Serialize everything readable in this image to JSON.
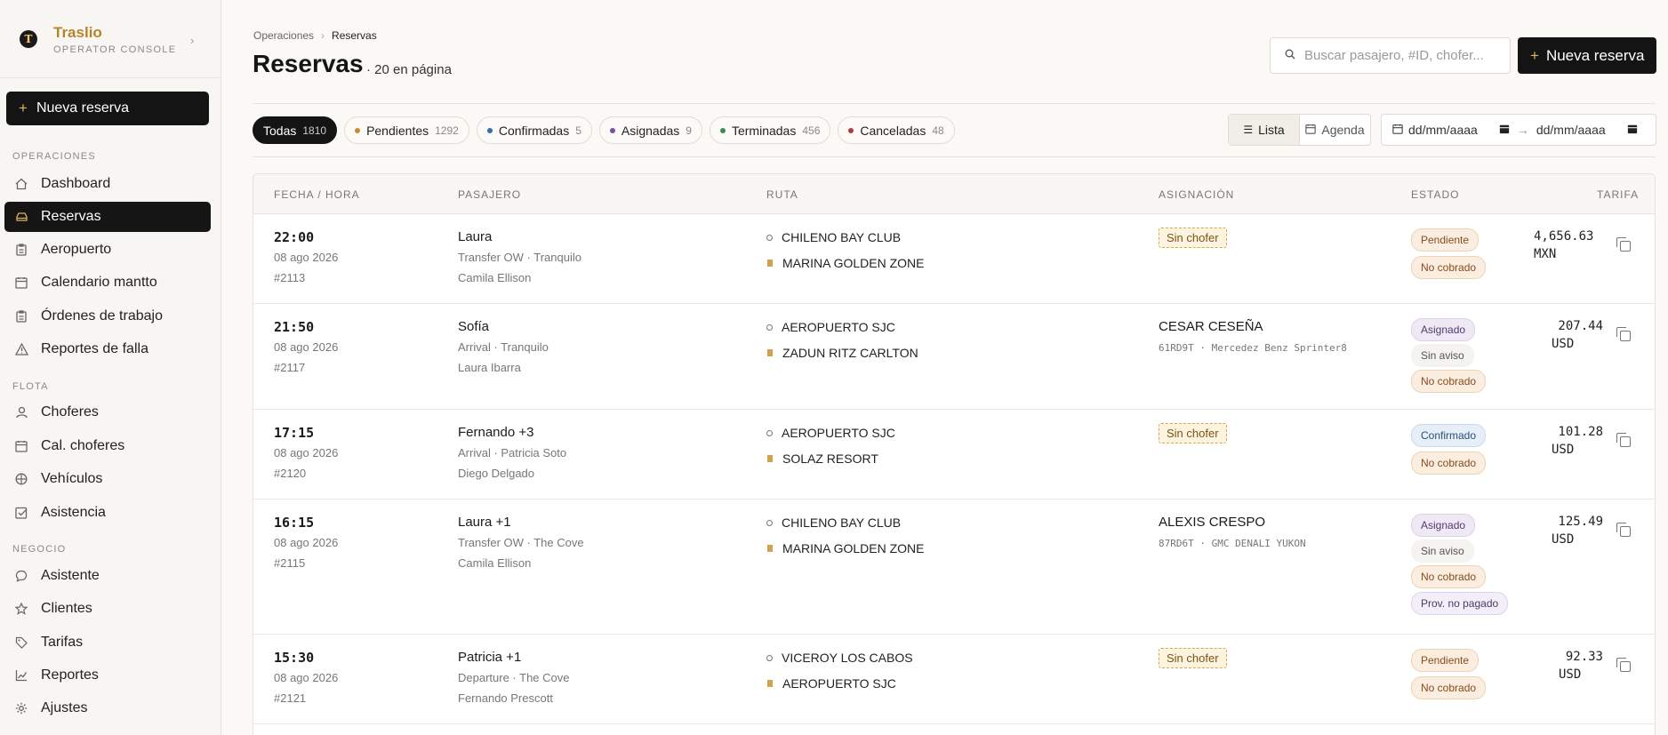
{
  "brand": {
    "name": "Traslio",
    "subtitle": "OPERATOR CONSOLE"
  },
  "sidebar": {
    "new_button": "Nueva reserva",
    "sections": [
      {
        "label": "OPERACIONES",
        "items": [
          {
            "label": "Dashboard",
            "icon": "home-icon"
          },
          {
            "label": "Reservas",
            "icon": "car-icon",
            "active": true
          },
          {
            "label": "Aeropuerto",
            "icon": "clipboard-icon"
          },
          {
            "label": "Calendario mantto",
            "icon": "calendar-icon"
          },
          {
            "label": "Órdenes de trabajo",
            "icon": "clipboard-icon"
          },
          {
            "label": "Reportes de falla",
            "icon": "warning-icon"
          }
        ]
      },
      {
        "label": "FLOTA",
        "items": [
          {
            "label": "Choferes",
            "icon": "user-icon"
          },
          {
            "label": "Cal. choferes",
            "icon": "calendar-icon"
          },
          {
            "label": "Vehículos",
            "icon": "globe-icon"
          },
          {
            "label": "Asistencia",
            "icon": "check-square-icon"
          }
        ]
      },
      {
        "label": "NEGOCIO",
        "items": [
          {
            "label": "Asistente",
            "icon": "chat-icon"
          },
          {
            "label": "Clientes",
            "icon": "star-icon"
          },
          {
            "label": "Tarifas",
            "icon": "tag-icon"
          },
          {
            "label": "Reportes",
            "icon": "chart-icon"
          },
          {
            "label": "Ajustes",
            "icon": "gear-icon"
          }
        ]
      }
    ]
  },
  "header": {
    "breadcrumb": [
      "Operaciones",
      "Reservas"
    ],
    "title": "Reservas",
    "count_text": "· 20 en página",
    "search_placeholder": "Buscar pasajero, #ID, chofer...",
    "new_button": "Nueva reserva"
  },
  "filters": [
    {
      "label": "Todas",
      "count": "1810",
      "active": true,
      "color": ""
    },
    {
      "label": "Pendientes",
      "count": "1292",
      "color": "#c98a2e"
    },
    {
      "label": "Confirmadas",
      "count": "5",
      "color": "#3b6ea8"
    },
    {
      "label": "Asignadas",
      "count": "9",
      "color": "#7a4fa0"
    },
    {
      "label": "Terminadas",
      "count": "456",
      "color": "#3e8a4f"
    },
    {
      "label": "Canceladas",
      "count": "48",
      "color": "#b23a3a"
    }
  ],
  "view": {
    "list": "Lista",
    "agenda": "Agenda"
  },
  "daterange": {
    "from": "dd/mm/aaaa",
    "to": "dd/mm/aaaa"
  },
  "table": {
    "headers": {
      "date": "FECHA / HORA",
      "passenger": "PASAJERO",
      "route": "RUTA",
      "assignment": "ASIGNACIÓN",
      "status": "ESTADO",
      "fare": "TARIFA"
    },
    "rows": [
      {
        "time": "22:00",
        "date": "08 ago 2026",
        "id": "#2113",
        "passenger": "Laura",
        "service": "Transfer OW · Tranquilo",
        "agent": "Camila Ellison",
        "from": "CHILENO BAY CLUB",
        "to": "MARINA GOLDEN ZONE",
        "assignment": "Sin chofer",
        "vehicle": "",
        "badges": [
          "Pendiente",
          "No cobrado"
        ],
        "fare": "4,656.63",
        "currency": "MXN"
      },
      {
        "time": "21:50",
        "date": "08 ago 2026",
        "id": "#2117",
        "passenger": "Sofía",
        "service": "Arrival · Tranquilo",
        "agent": "Laura Ibarra",
        "from": "AEROPUERTO SJC",
        "to": "ZADUN RITZ CARLTON",
        "assignment": "CESAR CESEÑA",
        "vehicle": "61RD9T · Mercedez Benz Sprinter8",
        "badges": [
          "Asignado",
          "Sin aviso",
          "No cobrado"
        ],
        "fare": "207.44",
        "currency": "USD"
      },
      {
        "time": "17:15",
        "date": "08 ago 2026",
        "id": "#2120",
        "passenger": "Fernando +3",
        "service": "Arrival · Patricia Soto",
        "agent": "Diego Delgado",
        "from": "AEROPUERTO SJC",
        "to": "SOLAZ RESORT",
        "assignment": "Sin chofer",
        "vehicle": "",
        "badges": [
          "Confirmado",
          "No cobrado"
        ],
        "fare": "101.28",
        "currency": "USD"
      },
      {
        "time": "16:15",
        "date": "08 ago 2026",
        "id": "#2115",
        "passenger": "Laura +1",
        "service": "Transfer OW · The Cove",
        "agent": "Camila Ellison",
        "from": "CHILENO BAY CLUB",
        "to": "MARINA GOLDEN ZONE",
        "assignment": "ALEXIS CRESPO",
        "vehicle": "87RD6T · GMC DENALI YUKON",
        "badges": [
          "Asignado",
          "Sin aviso",
          "No cobrado",
          "Prov. no pagado"
        ],
        "fare": "125.49",
        "currency": "USD"
      },
      {
        "time": "15:30",
        "date": "08 ago 2026",
        "id": "#2121",
        "passenger": "Patricia +1",
        "service": "Departure · The Cove",
        "agent": "Fernando Prescott",
        "from": "VICEROY LOS CABOS",
        "to": "AEROPUERTO SJC",
        "assignment": "Sin chofer",
        "vehicle": "",
        "badges": [
          "Pendiente",
          "No cobrado"
        ],
        "fare": "92.33",
        "currency": "USD"
      }
    ]
  }
}
